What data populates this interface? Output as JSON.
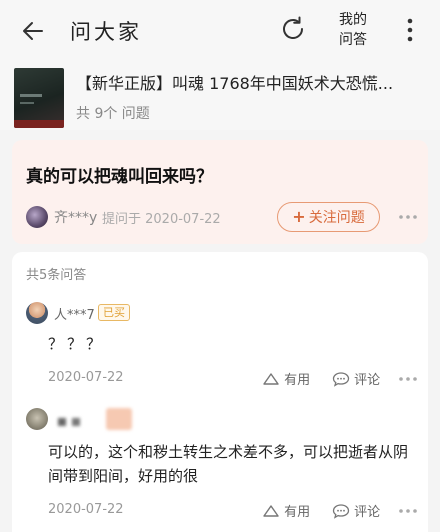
{
  "header": {
    "title": "问大家",
    "my_questions_line1": "我的",
    "my_questions_line2": "问答"
  },
  "book": {
    "title": "【新华正版】叫魂 1768年中国妖术大恐慌...",
    "subtitle": "共 9个 问题"
  },
  "question": {
    "title": "真的可以把魂叫回来吗？",
    "asker": "齐***y",
    "asked_at": "提问于 2020-07-22",
    "follow_label": "关注问题",
    "follow_plus": "+"
  },
  "answers": {
    "count_label": "共5条问答",
    "items": [
      {
        "user": "人***7",
        "badge": "已买",
        "text": "？？？",
        "date": "2020-07-22",
        "useful_label": "有用",
        "comment_label": "评论"
      },
      {
        "user": "",
        "badge": "",
        "text": "可以的，这个和秽土转生之术差不多，可以把逝者从阴间带到阳间，好用的很",
        "date": "2020-07-22",
        "useful_label": "有用",
        "comment_label": "评论"
      }
    ]
  },
  "colors": {
    "accent": "#d86a3c",
    "badge": "#e0a033",
    "question_bg": "#fdf1ee"
  },
  "icons": {
    "back": "back-arrow-icon",
    "refresh": "refresh-icon",
    "more": "more-vertical-icon",
    "like": "triangle-up-icon",
    "comment": "speech-bubble-icon"
  }
}
